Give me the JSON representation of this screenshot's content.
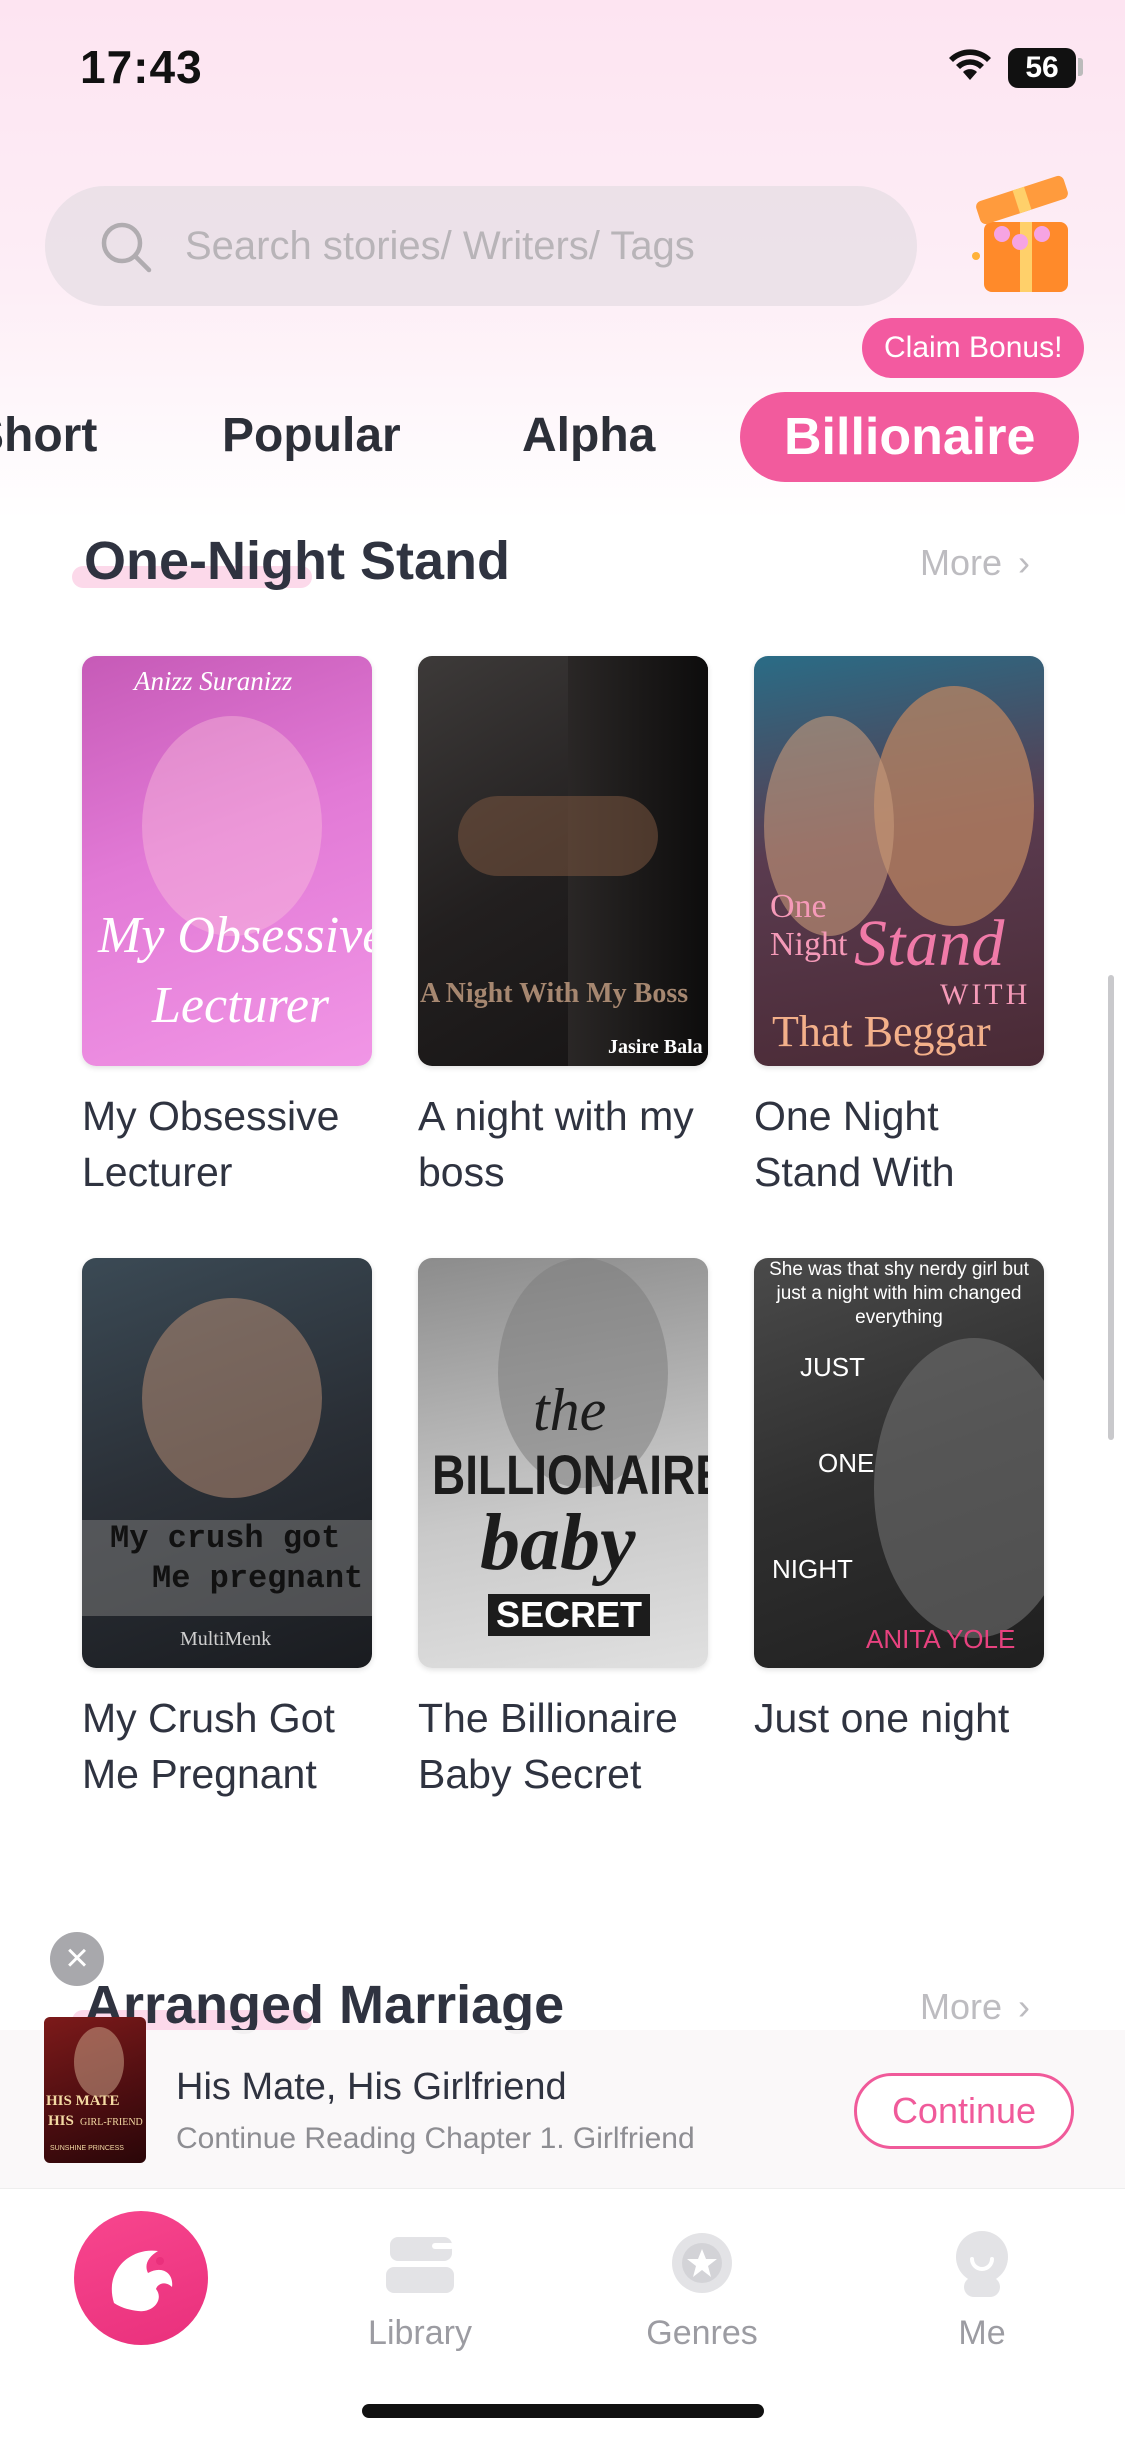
{
  "status_bar": {
    "time": "17:43",
    "battery": "56"
  },
  "search": {
    "placeholder": "Search stories/ Writers/ Tags"
  },
  "bonus": {
    "label": "Claim Bonus!"
  },
  "tabs": [
    {
      "label": "Short"
    },
    {
      "label": "Popular"
    },
    {
      "label": "Alpha"
    },
    {
      "label": "Billionaire",
      "active": true
    }
  ],
  "sections": [
    {
      "title": "One-Night Stand",
      "more": "More",
      "books": [
        {
          "title": "My Obsessive Lecturer",
          "cover_author": "Anizz Suranizz",
          "cover_title_1": "My Obsessive",
          "cover_title_2": "Lecturer"
        },
        {
          "title": "A night with my boss",
          "cover_title_1": "A Night With My Boss",
          "cover_author": "Jasire Bala"
        },
        {
          "title": "One Night Stand With",
          "cover_title_1": "One",
          "cover_title_2": "Night",
          "cover_title_3": "Stand",
          "cover_title_4": "WITH",
          "cover_title_5": "That Beggar"
        },
        {
          "title": "My Crush Got Me Pregnant",
          "cover_title_1": "My crush got",
          "cover_title_2": "Me pregnant",
          "cover_author": "MultiMenk"
        },
        {
          "title": "The Billionaire Baby Secret",
          "cover_title_1": "the",
          "cover_title_2": "BILLIONAIRE",
          "cover_title_3": "baby",
          "cover_title_4": "SECRET"
        },
        {
          "title": "Just one night",
          "cover_tagline": "She was that shy nerdy girl but just a night with him changed everything",
          "cover_title_1": "JUST",
          "cover_title_2": "ONE",
          "cover_title_3": "NIGHT",
          "cover_author": "ANITA YOLE"
        }
      ]
    },
    {
      "title": "Arranged Marriage",
      "more": "More"
    }
  ],
  "mini_player": {
    "title": "His Mate, His Girlfriend",
    "subtitle": "Continue Reading Chapter 1. Girlfriend",
    "button": "Continue",
    "cover_title_1": "HIS MATE",
    "cover_title_2": "HIS",
    "cover_title_3": "GIRL-FRIEND",
    "cover_author": "SUNSHINE PRINCESS"
  },
  "nav": {
    "library": "Library",
    "genres": "Genres",
    "me": "Me"
  },
  "colors": {
    "accent": "#f25b9d",
    "text": "#2f3340",
    "muted": "#bdbcc0"
  }
}
